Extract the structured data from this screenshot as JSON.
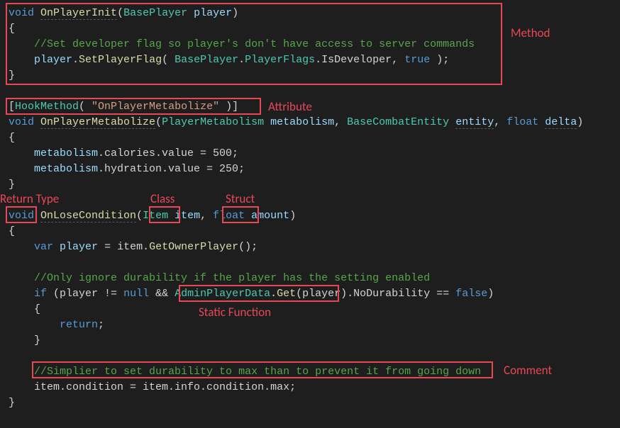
{
  "code": {
    "l1_void": "void",
    "l1_method": "OnPlayerInit",
    "l1_ptype": "BasePlayer",
    "l1_pname": "player",
    "l2": "{",
    "l3_comment": "//Set developer flag so player's don't have access to server commands",
    "l4_player": "player",
    "l4_dot1": ".",
    "l4_setflag": "SetPlayerFlag",
    "l4_open": "( ",
    "l4_bp": "BasePlayer",
    "l4_dot2": ".",
    "l4_pf": "PlayerFlags",
    "l4_dot3": ".",
    "l4_isdev": "IsDeveloper",
    "l4_comma": ", ",
    "l4_true": "true",
    "l4_close": " );",
    "l5": "}",
    "l6_open": "[",
    "l6_hook": "HookMethod",
    "l6_p1": "( ",
    "l6_str": "\"OnPlayerMetabolize\"",
    "l6_p2": " )]",
    "l7_void": "void",
    "l7_method": "OnPlayerMetabolize",
    "l7_op": "(",
    "l7_t1": "PlayerMetabolism",
    "l7_p1": "metabolism",
    "l7_c1": ", ",
    "l7_t2": "BaseCombatEntity",
    "l7_p2": "entity",
    "l7_c2": ", ",
    "l7_t3": "float",
    "l7_p3": "delta",
    "l7_cl": ")",
    "l8": "{",
    "l9_m": "metabolism",
    "l9_rest": ".calories.value = 500;",
    "l10_m": "metabolism",
    "l10_rest": ".hydration.value = 250;",
    "l11": "}",
    "l12_void": "void",
    "l12_method": "OnLoseCondition",
    "l12_op": "(",
    "l12_item_t": "Item",
    "l12_item_p": "item",
    "l12_c": ", ",
    "l12_float": "float",
    "l12_amt": "amount",
    "l12_cl": ")",
    "l13": "{",
    "l14_var": "var",
    "l14_player": "player",
    "l14_eq": " = item.",
    "l14_get": "GetOwnerPlayer",
    "l14_end": "();",
    "l15_comment": "//Only ignore durability if the player has the setting enabled",
    "l16_if": "if",
    "l16_op": " (player != ",
    "l16_null": "null",
    "l16_and": " && ",
    "l16_apd": "AdminPlayerData",
    "l16_dot": ".",
    "l16_get": "Get",
    "l16_po": "(player)",
    "l16_nodur": ".NoDurability == ",
    "l16_false": "false",
    "l16_cl": ")",
    "l17": "{",
    "l18_ret": "return",
    "l18_semi": ";",
    "l19": "}",
    "l20_comment": "//Simplier to set durability to max than to prevent it from going down",
    "l21": "item.condition = item.info.condition.max;",
    "l22": "}"
  },
  "labels": {
    "method": "Method",
    "attribute": "Attribute",
    "class": "Class",
    "struct": "Struct",
    "return_type": "Return Type",
    "static_function": "Static Function",
    "comment": "Comment"
  }
}
